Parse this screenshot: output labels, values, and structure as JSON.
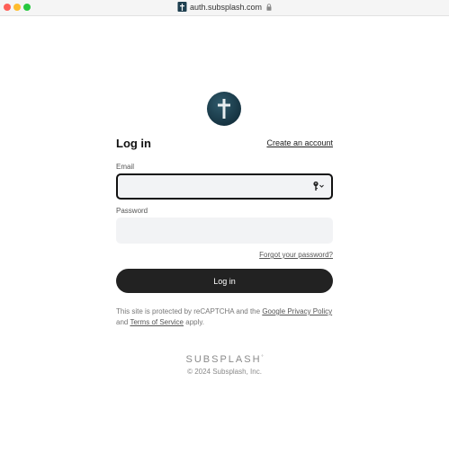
{
  "browser": {
    "url": "auth.subsplash.com",
    "favicon": "cross-icon",
    "secure_icon": "lock-icon"
  },
  "brand_logo": "cross-icon",
  "form": {
    "title": "Log in",
    "create_account": "Create an account",
    "email_label": "Email",
    "email_value": "",
    "password_label": "Password",
    "password_value": "",
    "forgot_password": "Forgot your password?",
    "submit": "Log in"
  },
  "legal": {
    "prefix": "This site is protected by reCAPTCHA and the",
    "privacy": "Google Privacy Policy",
    "and": "and",
    "terms": "Terms of Service",
    "suffix": "apply."
  },
  "footer": {
    "brand": "SUBSPLASH",
    "brand_mark": "°",
    "copyright": "© 2024 Subsplash, Inc."
  },
  "colors": {
    "button": "#222222",
    "logo": "#1e3f4f",
    "field": "#f2f3f5"
  }
}
